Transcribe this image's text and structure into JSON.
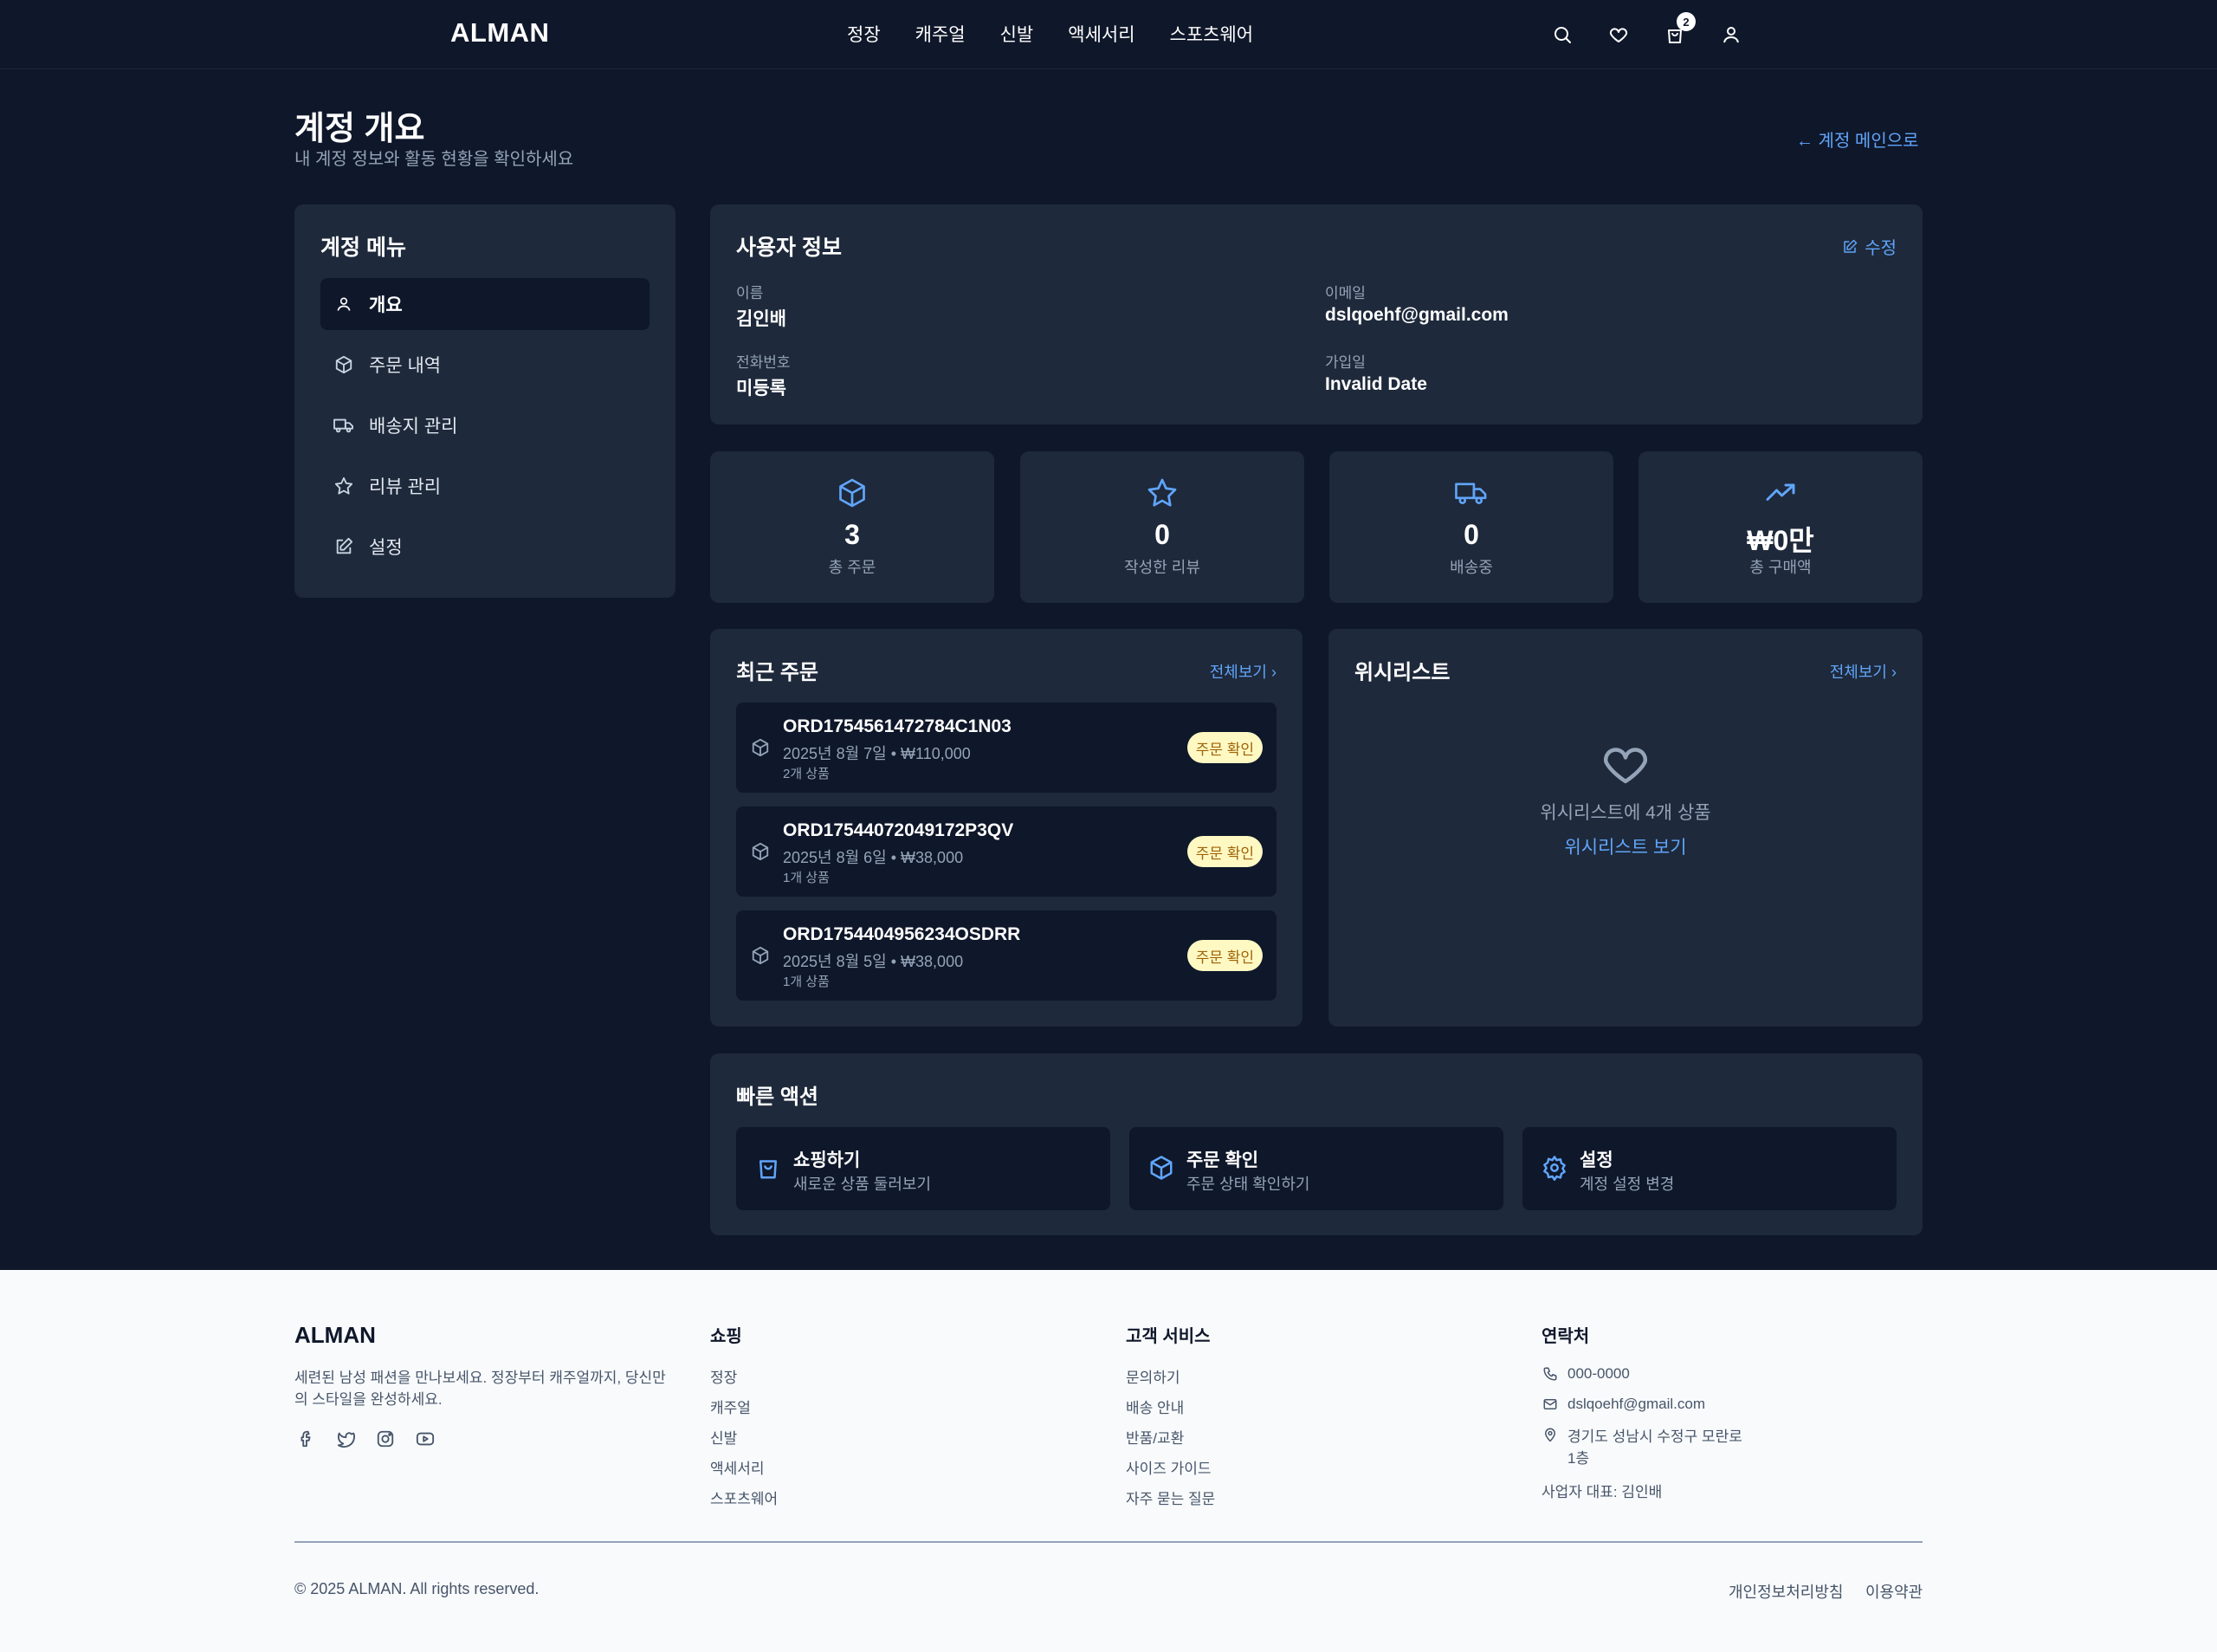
{
  "header": {
    "logo": "ALMAN",
    "nav": [
      "정장",
      "캐주얼",
      "신발",
      "액세서리",
      "스포츠웨어"
    ],
    "cart_count": "2",
    "icons": [
      "search-icon",
      "heart-icon",
      "shopping-bag-icon",
      "user-icon"
    ]
  },
  "page": {
    "title": "계정 개요",
    "subtitle": "내 계정 정보와 활동 현황을 확인하세요",
    "back_link": "← 계정 메인으로"
  },
  "sidebar": {
    "title": "계정 메뉴",
    "items": [
      {
        "label": "개요",
        "icon": "user-icon",
        "active": true
      },
      {
        "label": "주문 내역",
        "icon": "package-icon"
      },
      {
        "label": "배송지 관리",
        "icon": "truck-icon"
      },
      {
        "label": "리뷰 관리",
        "icon": "star-icon"
      },
      {
        "label": "설정",
        "icon": "edit-icon"
      }
    ]
  },
  "user_info": {
    "title": "사용자 정보",
    "edit_label": "수정",
    "name_label": "이름",
    "name": "김인배",
    "email_label": "이메일",
    "email": "dslqoehf@gmail.com",
    "phone_label": "전화번호",
    "phone": "미등록",
    "joined_label": "가입일",
    "joined": "Invalid Date"
  },
  "stats": [
    {
      "value": "3",
      "label": "총 주문",
      "icon": "package-icon"
    },
    {
      "value": "0",
      "label": "작성한 리뷰",
      "icon": "star-icon"
    },
    {
      "value": "0",
      "label": "배송중",
      "icon": "truck-icon"
    },
    {
      "value": "₩0만",
      "label": "총 구매액",
      "icon": "trending-up-icon"
    }
  ],
  "recent_orders": {
    "title": "최근 주문",
    "see_all": "전체보기 ›",
    "items": [
      {
        "id": "ORD1754561472784C1N03",
        "meta": "2025년 8월 7일 • ₩110,000",
        "count": "2개 상품",
        "status": "주문 확인"
      },
      {
        "id": "ORD17544072049172P3QV",
        "meta": "2025년 8월 6일 • ₩38,000",
        "count": "1개 상품",
        "status": "주문 확인"
      },
      {
        "id": "ORD1754404956234OSDRR",
        "meta": "2025년 8월 5일 • ₩38,000",
        "count": "1개 상품",
        "status": "주문 확인"
      }
    ],
    "status_color": "#fef9c3"
  },
  "wishlist": {
    "title": "위시리스트",
    "see_all": "전체보기 ›",
    "text": "위시리스트에 4개 상품",
    "link": "위시리스트 보기"
  },
  "quick_actions": {
    "title": "빠른 액션",
    "items": [
      {
        "title": "쇼핑하기",
        "sub": "새로운 상품 둘러보기",
        "icon": "shopping-bag-icon"
      },
      {
        "title": "주문 확인",
        "sub": "주문 상태 확인하기",
        "icon": "package-icon"
      },
      {
        "title": "설정",
        "sub": "계정 설정 변경",
        "icon": "gear-icon"
      }
    ]
  },
  "footer": {
    "logo": "ALMAN",
    "desc": "세련된 남성 패션을 만나보세요. 정장부터 캐주얼까지, 당신만의 스타일을 완성하세요.",
    "social": [
      "facebook-icon",
      "twitter-icon",
      "instagram-icon",
      "youtube-icon"
    ],
    "shopping_title": "쇼핑",
    "shopping_links": [
      "정장",
      "캐주얼",
      "신발",
      "액세서리",
      "스포츠웨어"
    ],
    "service_title": "고객 서비스",
    "service_links": [
      "문의하기",
      "배송 안내",
      "반품/교환",
      "사이즈 가이드",
      "자주 묻는 질문"
    ],
    "contact_title": "연락처",
    "phone": "000-0000",
    "email": "dslqoehf@gmail.com",
    "address_line1": "경기도 성남시 수정구 모란로",
    "address_line2": "1층",
    "ceo": "사업자 대표: 김인배",
    "copyright": "© 2025 ALMAN. All rights reserved.",
    "privacy": "개인정보처리방침",
    "terms": "이용약관"
  },
  "colors": {
    "background": "#0f172a",
    "card": "#1e293b",
    "accent": "#60a5fa",
    "muted": "#94a3b8"
  }
}
